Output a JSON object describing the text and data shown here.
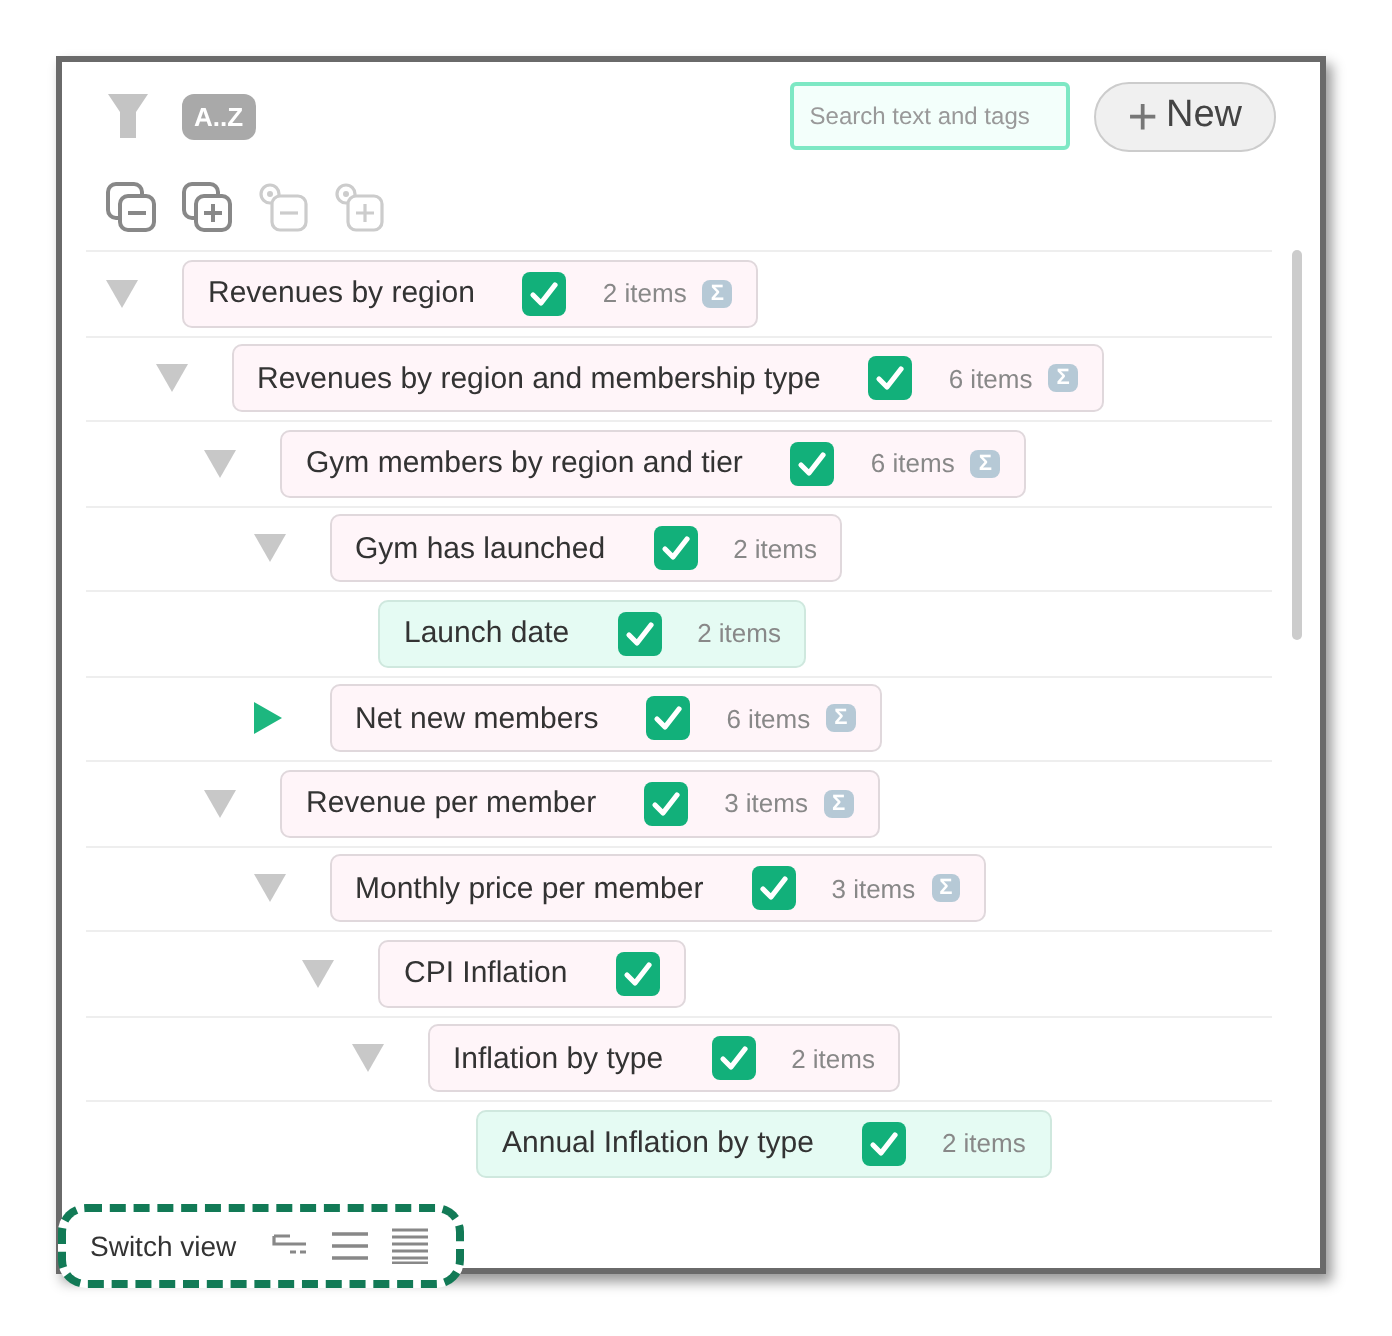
{
  "toolbar": {
    "sort_label": "A..Z",
    "search": {
      "placeholder": "Search text and tags"
    },
    "new_button": {
      "icon": "+",
      "label": "New"
    }
  },
  "tree": [
    {
      "label": "Revenues by region",
      "kind": "group",
      "expanded": true,
      "checked": true,
      "count": "2 items",
      "sigma": "Σ",
      "children": [
        {
          "label": "Revenues by region and membership type",
          "kind": "group",
          "expanded": true,
          "checked": true,
          "count": "6 items",
          "sigma": "Σ",
          "children": [
            {
              "label": "Gym members by region and tier",
              "kind": "group",
              "expanded": true,
              "checked": true,
              "count": "6 items",
              "sigma": "Σ",
              "children": [
                {
                  "label": "Gym has launched",
                  "kind": "group",
                  "expanded": true,
                  "checked": true,
                  "count": "2 items",
                  "children": [
                    {
                      "label": "Launch date",
                      "kind": "field",
                      "checked": true,
                      "count": "2 items"
                    }
                  ]
                },
                {
                  "label": "Net new members",
                  "kind": "group",
                  "expanded": false,
                  "checked": true,
                  "count": "6 items",
                  "sigma": "Σ"
                }
              ]
            },
            {
              "label": "Revenue per member",
              "kind": "group",
              "expanded": true,
              "checked": true,
              "count": "3 items",
              "sigma": "Σ",
              "children": [
                {
                  "label": "Monthly price per member",
                  "kind": "group",
                  "expanded": true,
                  "checked": true,
                  "count": "3 items",
                  "sigma": "Σ",
                  "children": [
                    {
                      "label": "CPI Inflation",
                      "kind": "group",
                      "expanded": true,
                      "checked": true,
                      "children": [
                        {
                          "label": "Inflation by type",
                          "kind": "group",
                          "expanded": true,
                          "checked": true,
                          "count": "2 items",
                          "children": [
                            {
                              "label": "Annual Inflation by type",
                              "kind": "field",
                              "checked": true,
                              "count": "2 items"
                            }
                          ]
                        }
                      ]
                    }
                  ]
                }
              ]
            }
          ]
        }
      ]
    }
  ],
  "footer": {
    "label": "Switch view"
  }
}
